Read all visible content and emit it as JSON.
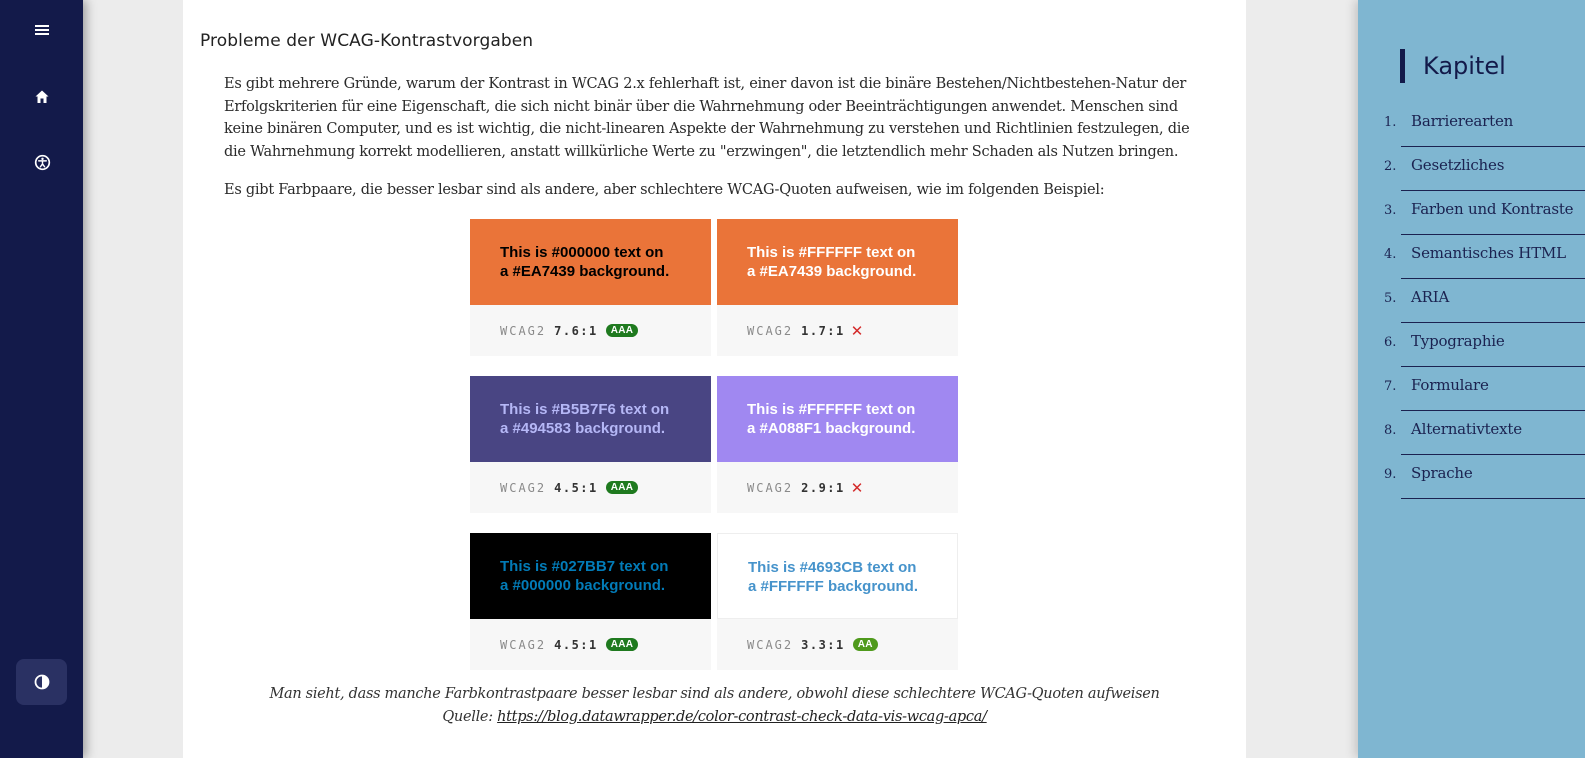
{
  "nav": {
    "menu_icon": "hamburger-menu-icon",
    "home_icon": "home-icon",
    "accessibility_icon": "accessibility-icon",
    "contrast_icon": "contrast-toggle-icon"
  },
  "section": {
    "heading": "Probleme der WCAG-Kontrastvorgaben",
    "para1": "Es gibt mehrere Gründe, warum der Kontrast in WCAG 2.x fehlerhaft ist, einer davon ist die binäre Bestehen/Nichtbestehen-Natur der Erfolgskriterien für eine Eigenschaft, die sich nicht binär über die Wahrnehmung oder Beeinträchtigungen anwendet. Menschen sind keine binären Computer, und es ist wichtig, die nicht-linearen Aspekte der Wahrnehmung zu verstehen und Richtlinien festzulegen, die die Wahrnehmung korrekt modellieren, anstatt willkürliche Werte zu \"erzwingen\", die letztendlich mehr Schaden als Nutzen bringen.",
    "para2": "Es gibt Farbpaare, die besser lesbar sind als andere, aber schlechtere WCAG-Quoten aufweisen, wie im folgenden Beispiel:",
    "caption": "Man sieht, dass manche Farbkontrastpaare besser lesbar sind als andere, obwohl diese schlechtere WCAG-Quoten aufweisen",
    "source_prefix": "Quelle: ",
    "source_link": "https://blog.datawrapper.de/color-contrast-check-data-vis-wcag-apca/"
  },
  "figure": {
    "cards": [
      {
        "line1": "This is #000000 text on",
        "line2": "a #EA7439 background.",
        "bg": "#EA7439",
        "fg": "#000000",
        "label": "WCAG2",
        "ratio": "7.6:1",
        "badge": "AAA",
        "badge_color": "#1f7a1f",
        "fail": ""
      },
      {
        "line1": "This is #FFFFFF text on",
        "line2": "a #EA7439 background.",
        "bg": "#EA7439",
        "fg": "#FFFFFF",
        "label": "WCAG2",
        "ratio": "1.7:1",
        "badge": "",
        "badge_color": "",
        "fail": "✕"
      },
      {
        "line1": "This is #B5B7F6 text on",
        "line2": "a #494583 background.",
        "bg": "#494583",
        "fg": "#B5B7F6",
        "label": "WCAG2",
        "ratio": "4.5:1",
        "badge": "AAA",
        "badge_color": "#1f7a1f",
        "fail": ""
      },
      {
        "line1": "This is #FFFFFF text on",
        "line2": "a #A088F1 background.",
        "bg": "#A088F1",
        "fg": "#FFFFFF",
        "label": "WCAG2",
        "ratio": "2.9:1",
        "badge": "",
        "badge_color": "",
        "fail": "✕"
      },
      {
        "line1": "This is #027BB7 text on",
        "line2": "a #000000 background.",
        "bg": "#000000",
        "fg": "#027BB7",
        "label": "WCAG2",
        "ratio": "4.5:1",
        "badge": "AAA",
        "badge_color": "#1f7a1f",
        "fail": ""
      },
      {
        "line1": "This is #4693CB text on",
        "line2": "a #FFFFFF background.",
        "bg": "#FFFFFF",
        "fg": "#4693CB",
        "label": "WCAG2",
        "ratio": "3.3:1",
        "badge": "AA",
        "badge_color": "#4f9a1c",
        "fail": ""
      }
    ]
  },
  "chapters": {
    "title": "Kapitel",
    "items": [
      {
        "num": "1.",
        "label": "Barrierearten"
      },
      {
        "num": "2.",
        "label": "Gesetzliches"
      },
      {
        "num": "3.",
        "label": "Farben und Kontraste"
      },
      {
        "num": "4.",
        "label": "Semantisches HTML"
      },
      {
        "num": "5.",
        "label": "ARIA"
      },
      {
        "num": "6.",
        "label": "Typographie"
      },
      {
        "num": "7.",
        "label": "Formulare"
      },
      {
        "num": "8.",
        "label": "Alternativtexte"
      },
      {
        "num": "9.",
        "label": "Sprache"
      }
    ]
  },
  "colors": {
    "nav_bg": "#131a4a",
    "chapters_bg": "#7fb6d1",
    "page_bg": "#ececec"
  }
}
